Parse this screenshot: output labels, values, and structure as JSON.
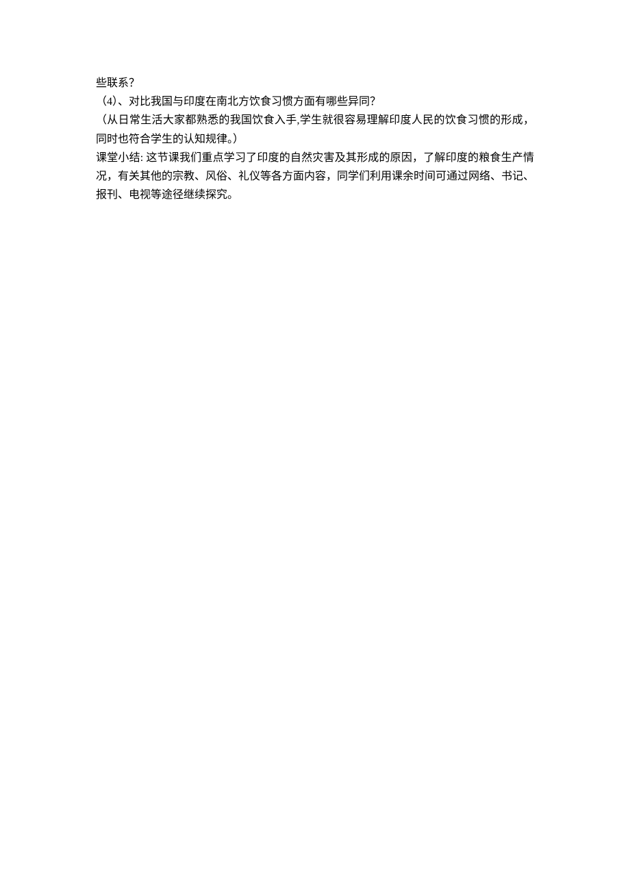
{
  "lines": {
    "l1": "些联系？",
    "l2": "（4）、对比我国与印度在南北方饮食习惯方面有哪些异同？",
    "l3": "（从日常生活大家都熟悉的我国饮食入手,学生就很容易理解印度人民的饮食习惯的形成，同时也符合学生的认知规律。）",
    "summary_label": "课堂小结:",
    "summary_text": " 这节课我们重点学习了印度的自然灾害及其形成的原因，了解印度的粮食生产情况，有关其他的宗教、风俗、礼仪等各方面内容，同学们利用课余时间可通过网络、书记、报刊、电视等途径继续探究。"
  }
}
